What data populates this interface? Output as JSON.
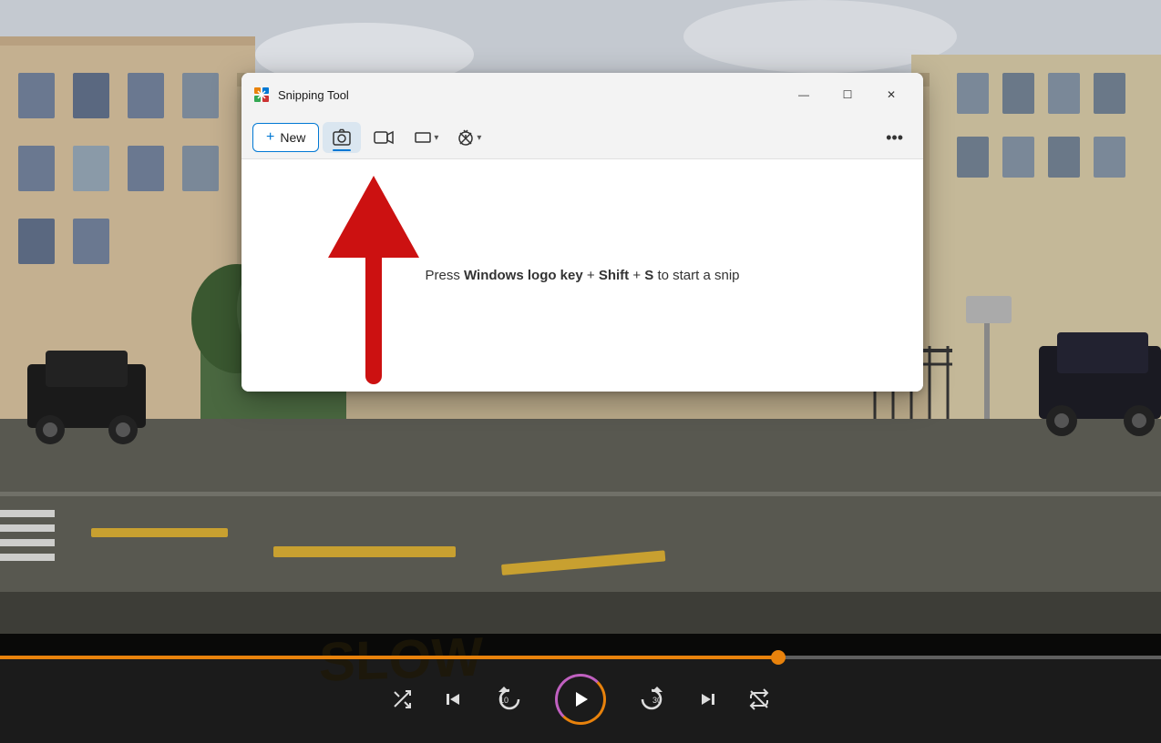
{
  "app": {
    "title": "Snipping Tool",
    "icon": "✂"
  },
  "window_controls": {
    "minimize": "—",
    "maximize": "☐",
    "close": "✕"
  },
  "toolbar": {
    "new_label": "New",
    "new_icon": "+",
    "camera_icon": "📷",
    "video_icon": "🎥",
    "shape_icon": "▭",
    "timer_icon": "⏰",
    "more_icon": "•••"
  },
  "content": {
    "hint_part1": "Press ",
    "hint_bold1": "Windows logo key",
    "hint_part2": " + ",
    "hint_bold2": "Shift",
    "hint_part3": " + ",
    "hint_bold3": "S",
    "hint_part4": " to start a snip",
    "full_hint": "Press Windows logo key + Shift + S to start a snip"
  },
  "player": {
    "progress_percent": 67,
    "controls": {
      "shuffle": "⇌",
      "prev": "⏮",
      "rewind": "10",
      "play": "▶",
      "forward": "30",
      "next": "⏭",
      "repeat": "↺"
    }
  },
  "colors": {
    "accent_blue": "#0078d4",
    "progress_orange": "#e8820c",
    "arrow_red": "#cc1111"
  }
}
